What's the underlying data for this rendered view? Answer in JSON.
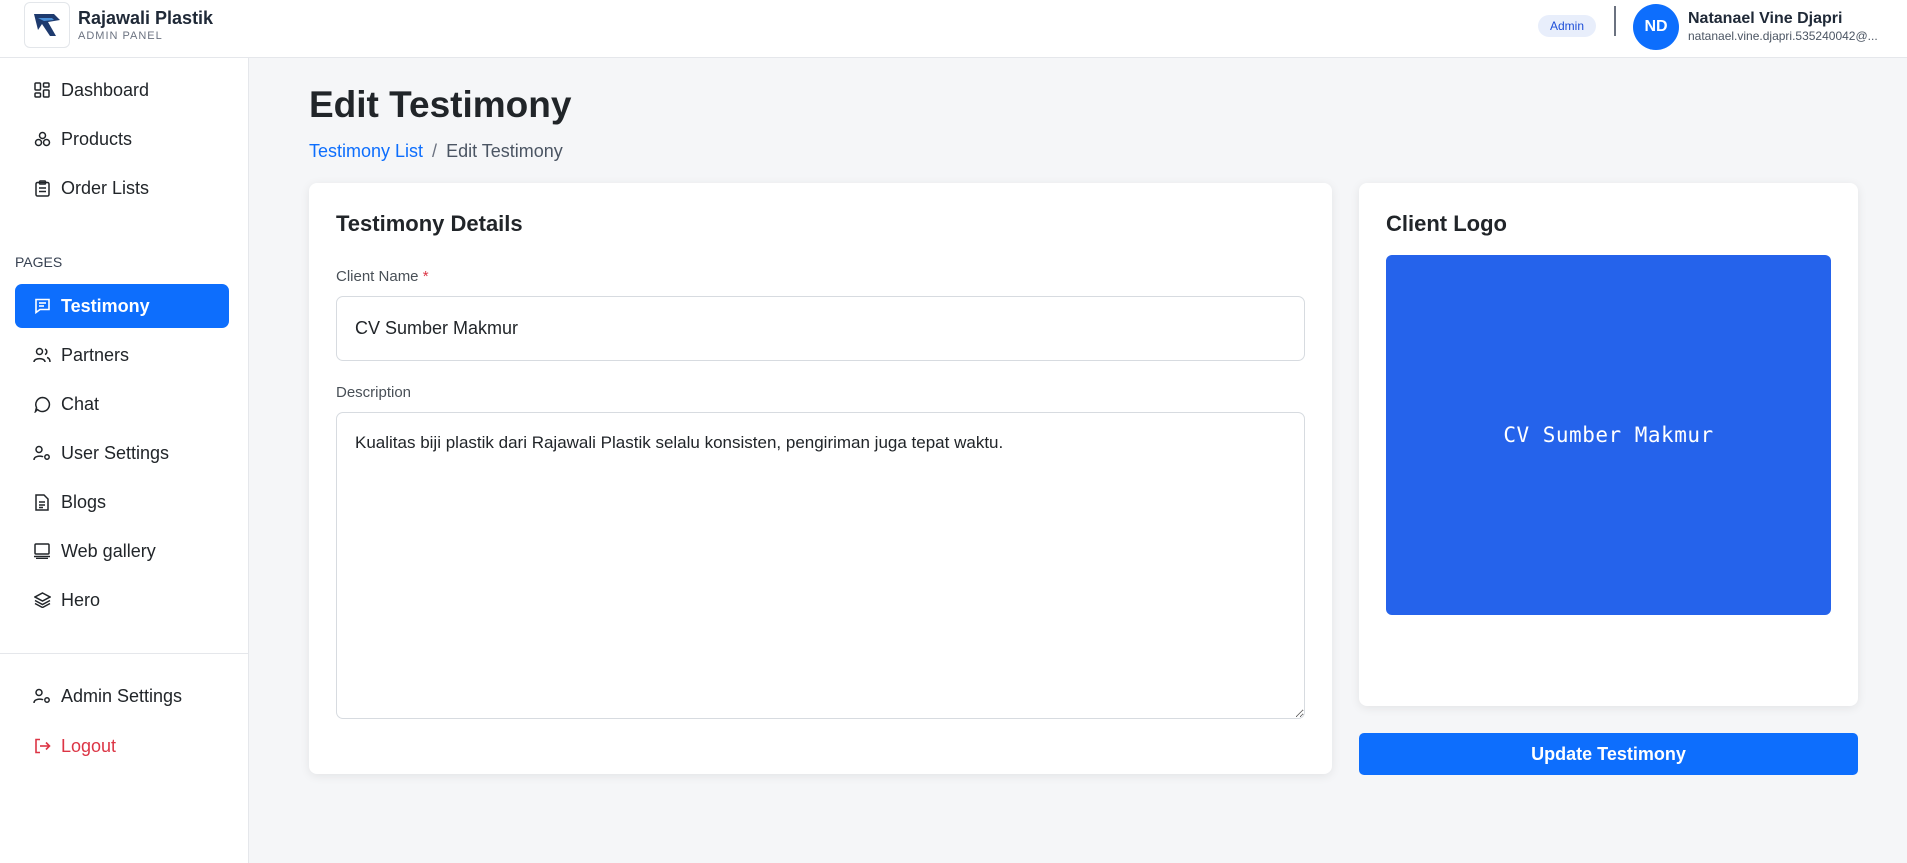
{
  "app": {
    "name": "Rajawali Plastik",
    "subtitle": "ADMIN PANEL"
  },
  "user": {
    "role": "Admin",
    "initials": "ND",
    "name": "Natanael Vine Djapri",
    "email": "natanael.vine.djapri.535240042@..."
  },
  "sidebar": {
    "top_items": [
      {
        "label": "Dashboard",
        "icon": "dashboard-icon"
      },
      {
        "label": "Products",
        "icon": "products-icon"
      },
      {
        "label": "Order Lists",
        "icon": "clipboard-icon"
      }
    ],
    "section_label": "PAGES",
    "page_items": [
      {
        "label": "Testimony",
        "icon": "message-icon",
        "active": true
      },
      {
        "label": "Partners",
        "icon": "users-icon"
      },
      {
        "label": "Chat",
        "icon": "chat-icon"
      },
      {
        "label": "User Settings",
        "icon": "user-gear-icon"
      },
      {
        "label": "Blogs",
        "icon": "document-icon"
      },
      {
        "label": "Web gallery",
        "icon": "gallery-icon"
      },
      {
        "label": "Hero",
        "icon": "layers-icon"
      }
    ],
    "bottom_items": [
      {
        "label": "Admin Settings",
        "icon": "user-gear-icon"
      },
      {
        "label": "Logout",
        "icon": "logout-icon"
      }
    ]
  },
  "page": {
    "title": "Edit Testimony",
    "breadcrumb": {
      "link": "Testimony List",
      "separator": "/",
      "current": "Edit Testimony"
    }
  },
  "details_card": {
    "title": "Testimony Details",
    "client_name_label": "Client Name",
    "required_mark": "*",
    "client_name_value": "CV Sumber Makmur",
    "description_label": "Description",
    "description_value": "Kualitas biji plastik dari Rajawali Plastik selalu konsisten, pengiriman juga tepat waktu."
  },
  "logo_card": {
    "title": "Client Logo",
    "logo_text": "CV Sumber Makmur",
    "logo_bg_color": "#2563eb"
  },
  "actions": {
    "update_label": "Update Testimony"
  },
  "colors": {
    "primary": "#0d6efd",
    "danger": "#dc3545"
  }
}
